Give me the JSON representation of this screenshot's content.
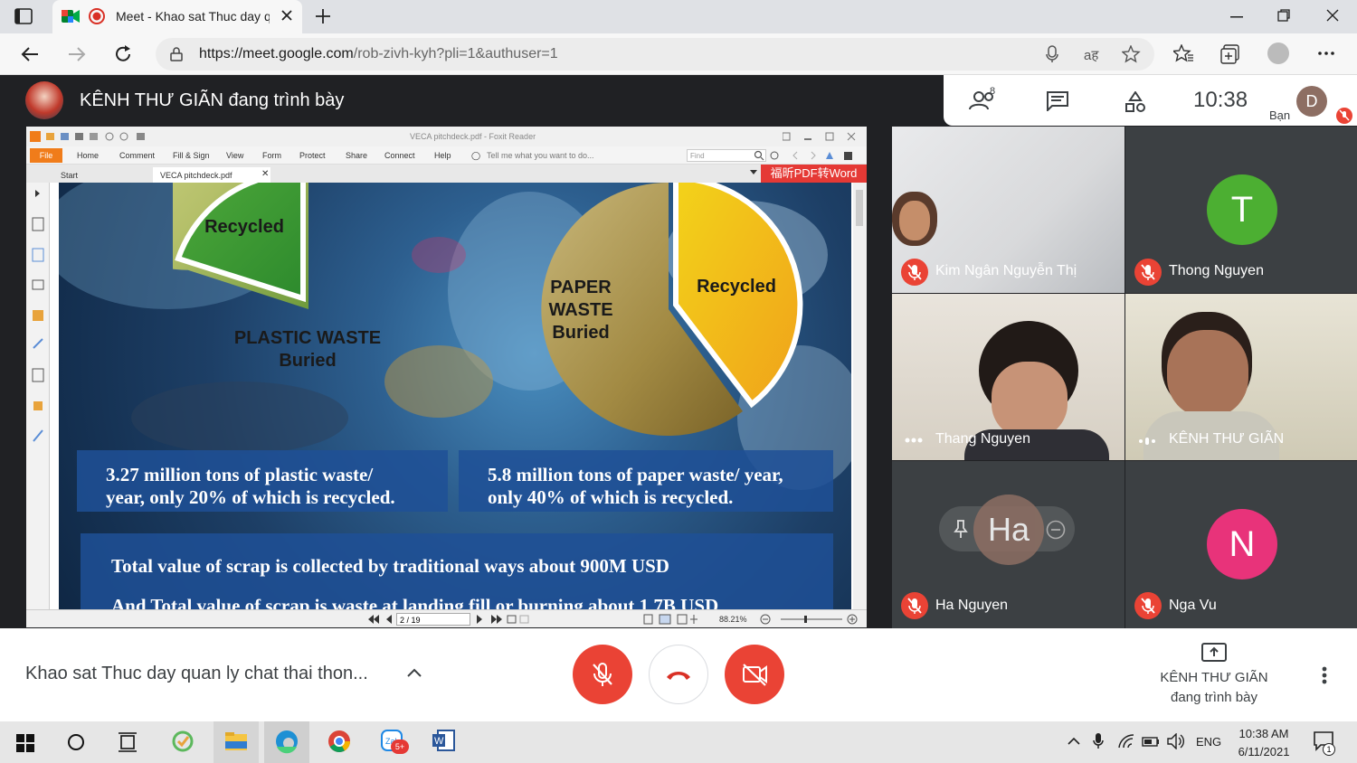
{
  "browser": {
    "tab_title": "Meet - Khao sat Thuc day q",
    "url_host": "https://meet.google.com",
    "url_path": "/rob-zivh-kyh?pli=1&authuser=1"
  },
  "meet": {
    "presenter_label": "KÊNH THƯ GIÃN đang trình bày",
    "participants_count": "8",
    "clock": "10:38",
    "you_label": "Bạn",
    "you_initial": "D",
    "participants": [
      {
        "name": "Kim Ngân Nguyễn Thị",
        "muted": true
      },
      {
        "name": "Thong Nguyen",
        "initial": "T",
        "color": "#4caf32",
        "muted": true
      },
      {
        "name": "Thang Nguyen",
        "muted": false
      },
      {
        "name": "KÊNH THƯ GIÃN",
        "muted": false
      },
      {
        "name": "Ha Nguyen",
        "initial": "Ha",
        "muted": true
      },
      {
        "name": "Nga Vu",
        "initial": "N",
        "color": "#e8337a",
        "muted": true
      }
    ],
    "meeting_title": "Khao sat Thuc day quan ly chat thai thon...",
    "presenting_line1": "KÊNH THƯ GIÃN",
    "presenting_line2": "đang trình bày"
  },
  "foxit": {
    "window_title": "VECA pitchdeck.pdf - Foxit Reader",
    "menu": [
      "File",
      "Home",
      "Comment",
      "Fill & Sign",
      "View",
      "Form",
      "Protect",
      "Share",
      "Connect",
      "Help"
    ],
    "tell_me": "Tell me what you want to do...",
    "find_placeholder": "Find",
    "tabs": [
      "Start",
      "VECA pitchdeck.pdf"
    ],
    "ad_banner": "福昕PDF转Word",
    "page_indicator": "2 / 19",
    "zoom": "88.21%"
  },
  "slide": {
    "plastic_recycled_label": "Recycled",
    "plastic_main_line1": "PLASTIC WASTE",
    "plastic_main_line2": "Buried",
    "paper_main_line1": "PAPER",
    "paper_main_line2": "WASTE",
    "paper_main_line3": "Buried",
    "paper_recycled_label": "Recycled",
    "plastic_stat_line1": "3.27 million tons of plastic waste/",
    "plastic_stat_line2": "year, only 20% of which is recycled.",
    "paper_stat_line1": "5.8 million tons of paper waste/  year,",
    "paper_stat_line2": "only 40% of which is recycled.",
    "total_line1": "Total value of scrap is collected by traditional ways about 900M USD",
    "total_line2": "And Total value of scrap is waste at landing fill or burning about 1,7B USD"
  },
  "taskbar": {
    "language": "ENG",
    "time": "10:38 AM",
    "date": "6/11/2021",
    "zalo_badge": "5+",
    "notification_count": "1"
  }
}
